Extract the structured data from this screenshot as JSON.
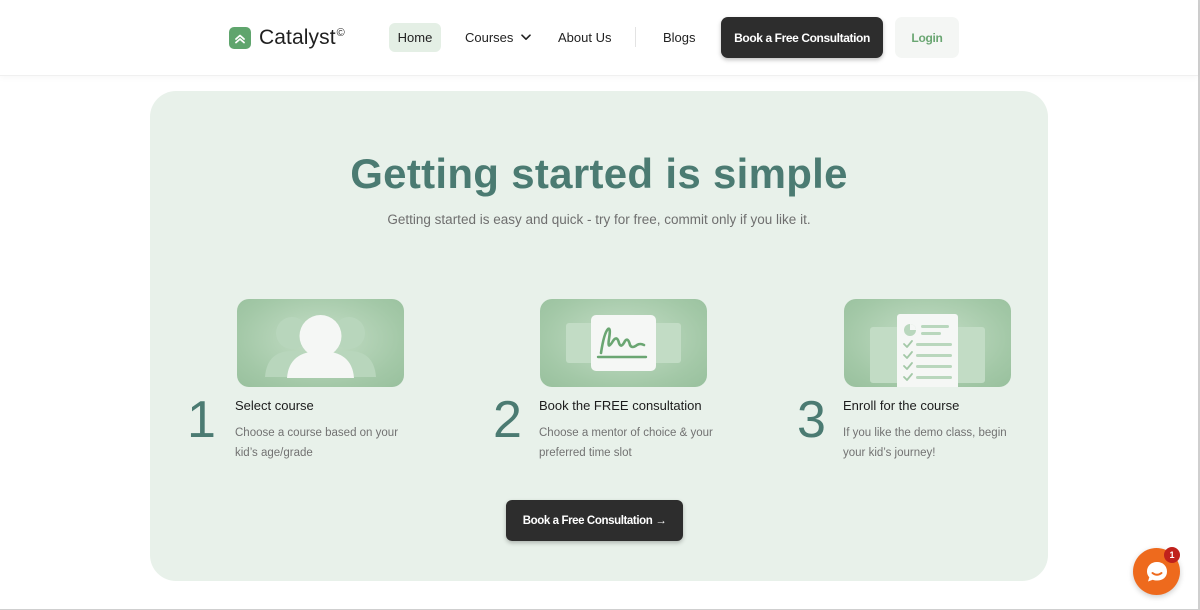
{
  "brand": {
    "name": "Catalyst",
    "mark": "©",
    "logo_icon": "chevrons-up-icon"
  },
  "nav": {
    "home": "Home",
    "courses": "Courses",
    "about": "About Us",
    "blogs": "Blogs",
    "cta": "Book a Free Consultation",
    "login": "Login"
  },
  "hero": {
    "title": "Getting started is simple",
    "subtitle": "Getting started is easy and quick - try for free, commit only if you like it."
  },
  "steps": [
    {
      "number": "1",
      "title": "Select course",
      "description": "Choose a course based on your kid’s age/grade",
      "icon": "users-icon"
    },
    {
      "number": "2",
      "title": "Book the FREE consultation",
      "description": "Choose a mentor of choice & your preferred time slot",
      "icon": "signature-icon"
    },
    {
      "number": "3",
      "title": "Enroll for the course",
      "description": "If you like the demo class, begin your kid’s journey!",
      "icon": "checklist-icon"
    }
  ],
  "main_cta": "Book a Free Consultation →",
  "chat": {
    "badge_count": "1",
    "icon": "chat-icon"
  },
  "colors": {
    "accent_green": "#5fa56d",
    "panel_bg": "#e8f1ea",
    "heading": "#4b7b72",
    "dark_button": "#2d2d2d",
    "chat_orange": "#ee6a1d"
  }
}
